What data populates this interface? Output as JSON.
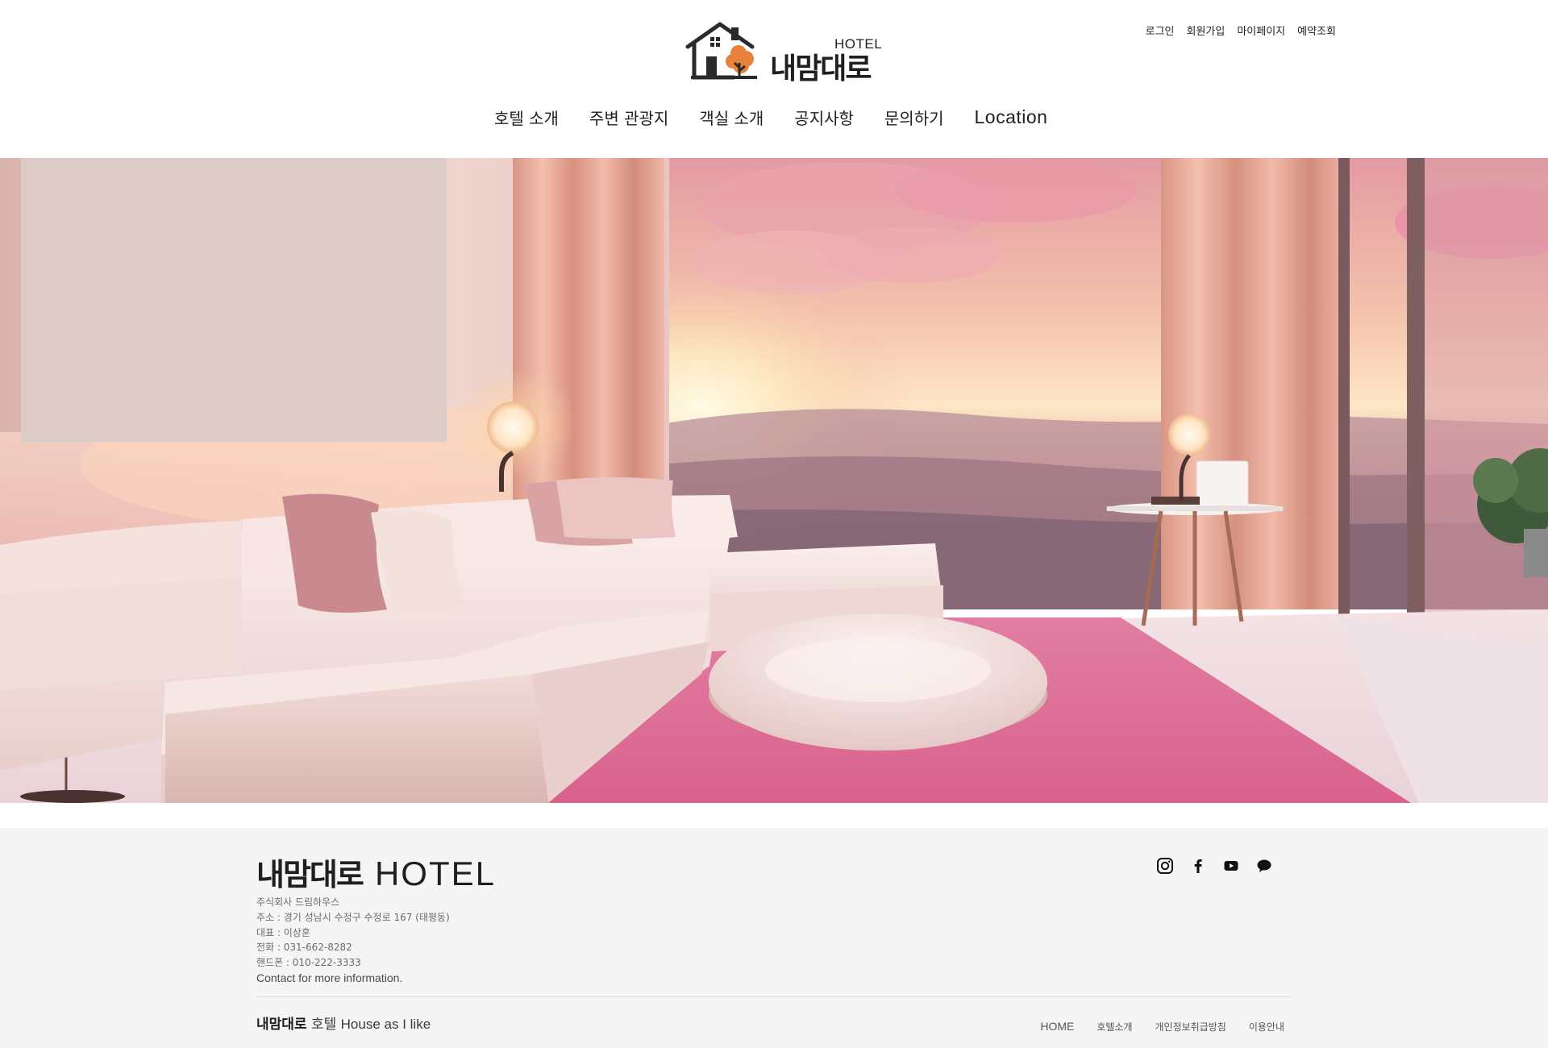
{
  "header": {
    "logo": {
      "hotel_label": "HOTEL",
      "name": "내맘대로"
    },
    "util_links": [
      "로그인",
      "회원가입",
      "마이페이지",
      "예약조회"
    ],
    "nav": [
      "호텔 소개",
      "주변 관광지",
      "객실 소개",
      "공지사항",
      "문의하기",
      "Location"
    ]
  },
  "hero": {
    "image": "pink-sunset-lounge-interior"
  },
  "footer": {
    "brand_kr": "내맘대로",
    "brand_en": "HOTEL",
    "info": [
      "주식회사 드림하우스",
      "주소 : 경기 성남시 수정구 수정로 167 (태평동)",
      "대표 : 이상훈",
      "전화 : 031-662-8282",
      "핸드폰 : 010-222-3333"
    ],
    "more_info": "Contact for more information.",
    "social": [
      "instagram-icon",
      "facebook-icon",
      "youtube-icon",
      "chat-icon"
    ],
    "tagline": {
      "name": "내맘대로",
      "kr": "호텔",
      "en": "House as I like"
    },
    "links": [
      "HOME",
      "호텔소개",
      "개인정보취급방침",
      "이용안내"
    ]
  },
  "colors": {
    "accent_pink": "#e8799a",
    "text_dark": "#1f1f1f",
    "footer_bg": "#f5f5f5",
    "logo_tree": "#e8823a"
  }
}
